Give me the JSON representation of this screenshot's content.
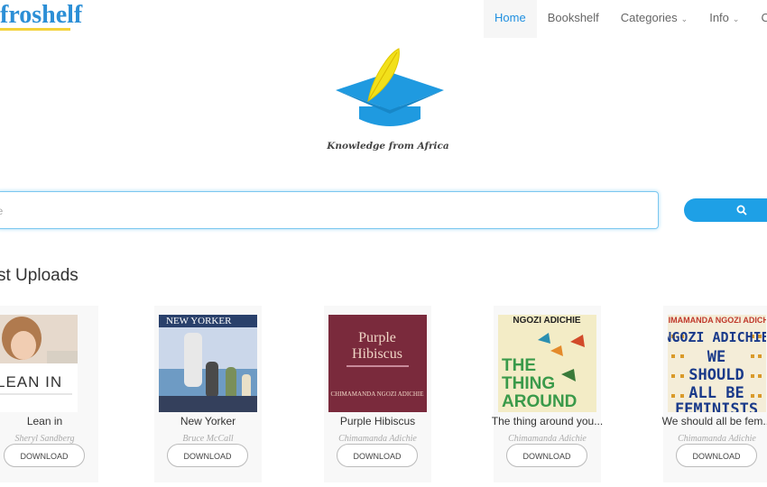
{
  "header": {
    "logo_text": "froshelf",
    "nav": [
      {
        "label": "Home",
        "active": true
      },
      {
        "label": "Bookshelf",
        "active": false
      },
      {
        "label": "Categories",
        "active": false,
        "dropdown": true
      },
      {
        "label": "Info",
        "active": false,
        "dropdown": true
      },
      {
        "label": "Co",
        "active": false
      }
    ]
  },
  "brand": {
    "tagline": "Knowledge from Africa",
    "accent": "#1f9ae0",
    "quill": "#f2e01a"
  },
  "search": {
    "placeholder": "le",
    "button_icon": "search-icon"
  },
  "section": {
    "title": "st Uploads"
  },
  "books": [
    {
      "title": "Lean in",
      "author": "Sheryl Sandberg",
      "button": "DOWNLOAD",
      "cover_text": "LEAN IN"
    },
    {
      "title": "New Yorker",
      "author": "Bruce McCall",
      "button": "DOWNLOAD",
      "cover_text": "NEW YORKER"
    },
    {
      "title": "Purple Hibiscus",
      "author": "Chimamanda Adichie",
      "button": "DOWNLOAD",
      "cover_text": "Purple Hibiscus",
      "cover_sub": "CHIMAMANDA NGOZI ADICHIE"
    },
    {
      "title": "The thing around you...",
      "author": "Chimamanda Adichie",
      "button": "DOWNLOAD",
      "cover_text": "THE THING AROUND",
      "cover_top": "NGOZI ADICHIE"
    },
    {
      "title": "We should all be fem...",
      "author": "Chimamanda Adichie",
      "button": "DOWNLOAD",
      "cover_text": "WE SHOULD ALL BE FEMINISTS",
      "cover_top": "CHIMAMANDA NGOZI ADICHIE"
    }
  ]
}
